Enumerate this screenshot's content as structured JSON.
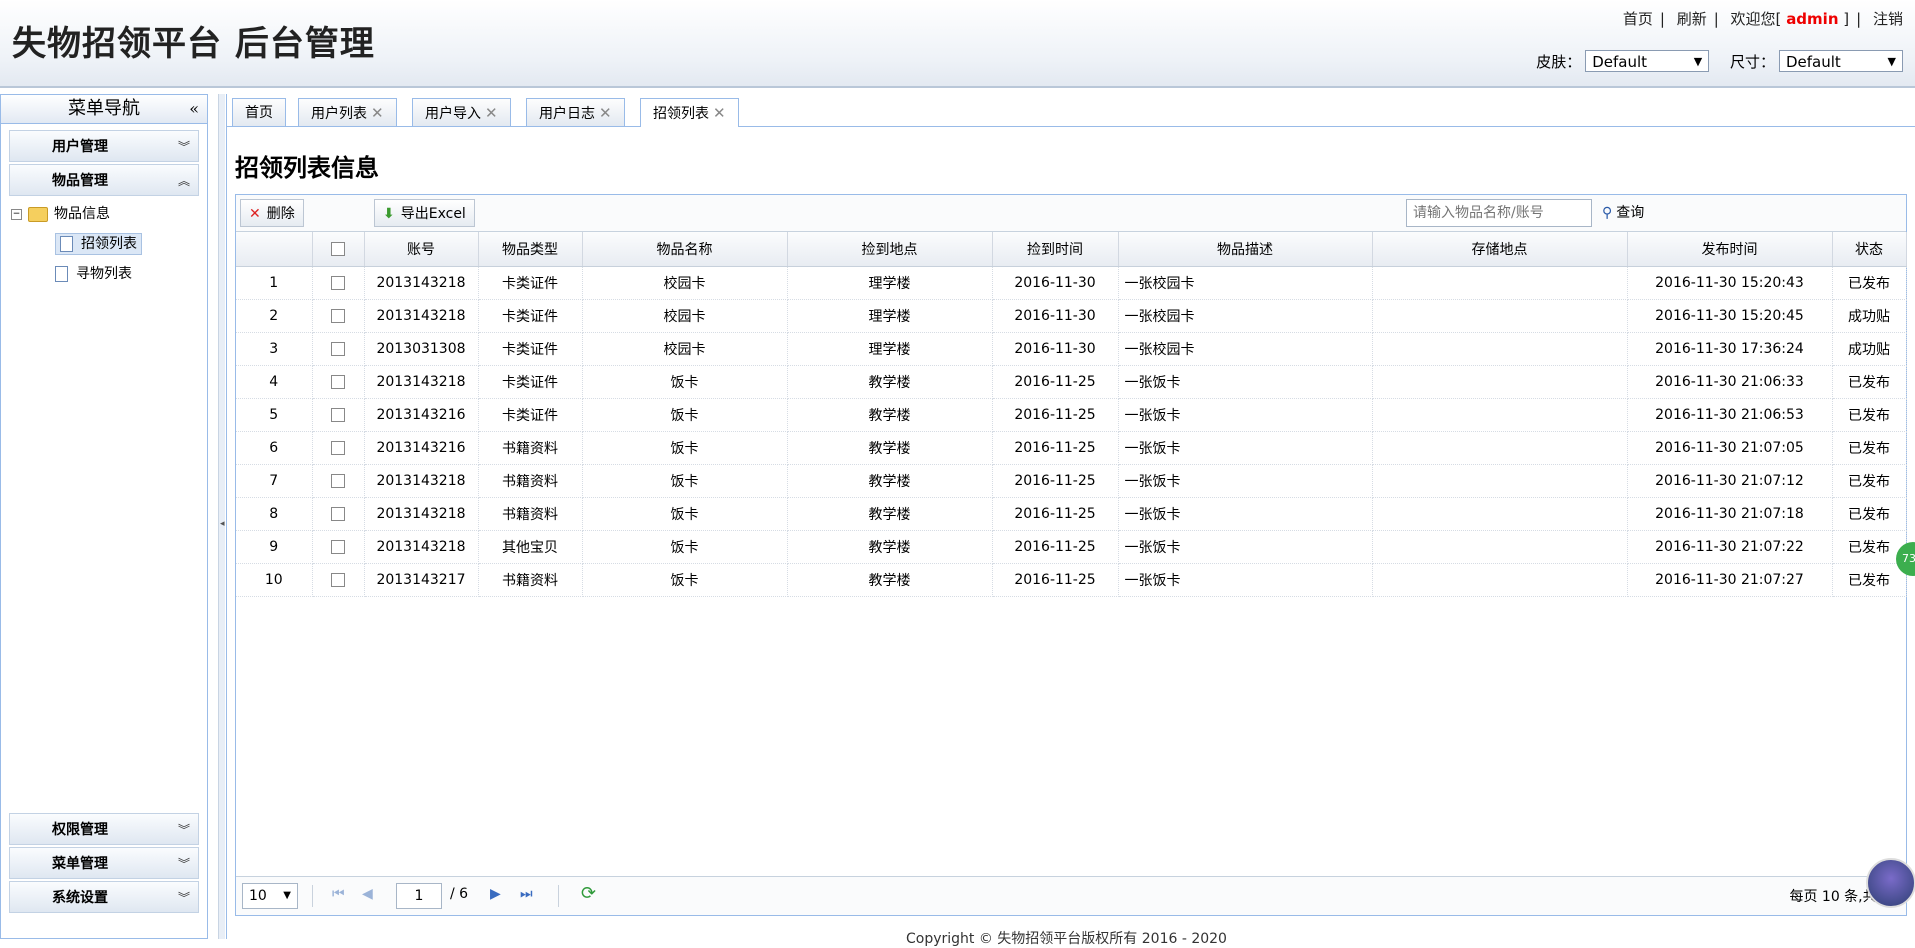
{
  "header": {
    "title": "失物招领平台 后台管理",
    "links": {
      "home": "首页",
      "refresh": "刷新",
      "welcome_prefix": "欢迎您[",
      "user": "admin",
      "welcome_suffix": "]",
      "logout": "注销"
    },
    "skin_label": "皮肤：",
    "skin_value": "Default",
    "size_label": "尺寸：",
    "size_value": "Default"
  },
  "sidebar": {
    "title": "菜单导航",
    "top_sections": [
      "用户管理",
      "物品管理"
    ],
    "tree": {
      "folder": "物品信息",
      "leaves": [
        "招领列表",
        "寻物列表"
      ]
    },
    "bottom_sections": [
      "权限管理",
      "菜单管理",
      "系统设置"
    ]
  },
  "tabs": [
    "首页",
    "用户列表",
    "用户导入",
    "用户日志",
    "招领列表"
  ],
  "page_title": "招领列表信息",
  "toolbar": {
    "delete": "删除",
    "export": "导出Excel",
    "search_placeholder": "请输入物品名称/账号",
    "search": "查询"
  },
  "columns": [
    "",
    "",
    "账号",
    "物品类型",
    "物品名称",
    "捡到地点",
    "捡到时间",
    "物品描述",
    "存储地点",
    "发布时间",
    "状态"
  ],
  "rows": [
    [
      "1",
      "2013143218",
      "卡类证件",
      "校园卡",
      "理学楼",
      "2016-11-30",
      "一张校园卡",
      "",
      "2016-11-30 15:20:43",
      "已发布"
    ],
    [
      "2",
      "2013143218",
      "卡类证件",
      "校园卡",
      "理学楼",
      "2016-11-30",
      "一张校园卡",
      "",
      "2016-11-30 15:20:45",
      "成功贴"
    ],
    [
      "3",
      "2013031308",
      "卡类证件",
      "校园卡",
      "理学楼",
      "2016-11-30",
      "一张校园卡",
      "",
      "2016-11-30 17:36:24",
      "成功贴"
    ],
    [
      "4",
      "2013143218",
      "卡类证件",
      "饭卡",
      "教学楼",
      "2016-11-25",
      "一张饭卡",
      "",
      "2016-11-30 21:06:33",
      "已发布"
    ],
    [
      "5",
      "2013143216",
      "卡类证件",
      "饭卡",
      "教学楼",
      "2016-11-25",
      "一张饭卡",
      "",
      "2016-11-30 21:06:53",
      "已发布"
    ],
    [
      "6",
      "2013143216",
      "书籍资料",
      "饭卡",
      "教学楼",
      "2016-11-25",
      "一张饭卡",
      "",
      "2016-11-30 21:07:05",
      "已发布"
    ],
    [
      "7",
      "2013143218",
      "书籍资料",
      "饭卡",
      "教学楼",
      "2016-11-25",
      "一张饭卡",
      "",
      "2016-11-30 21:07:12",
      "已发布"
    ],
    [
      "8",
      "2013143218",
      "书籍资料",
      "饭卡",
      "教学楼",
      "2016-11-25",
      "一张饭卡",
      "",
      "2016-11-30 21:07:18",
      "已发布"
    ],
    [
      "9",
      "2013143218",
      "其他宝贝",
      "饭卡",
      "教学楼",
      "2016-11-25",
      "一张饭卡",
      "",
      "2016-11-30 21:07:22",
      "已发布"
    ],
    [
      "10",
      "2013143217",
      "书籍资料",
      "饭卡",
      "教学楼",
      "2016-11-25",
      "一张饭卡",
      "",
      "2016-11-30 21:07:27",
      "已发布"
    ]
  ],
  "pager": {
    "page_size": "10",
    "page": "1",
    "total_pages": "/ 6",
    "info": "每页 10 条,共 6"
  },
  "footer": "Copyright © 失物招领平台版权所有  2016 - 2020",
  "float_badge": "73",
  "icons": {
    "delete": "cross-icon",
    "export": "down-arrow-icon",
    "search": "magnifier-icon",
    "refresh": "refresh-icon"
  }
}
